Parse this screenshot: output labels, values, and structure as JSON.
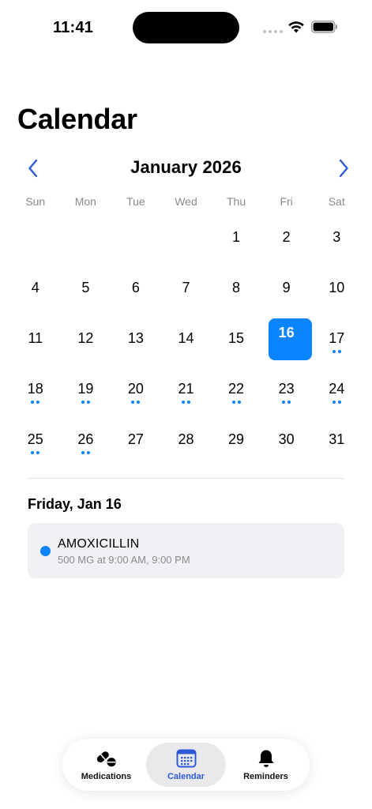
{
  "status_bar": {
    "time": "11:41"
  },
  "page": {
    "title": "Calendar"
  },
  "calendar": {
    "month_label": "January 2026",
    "weekdays": [
      "Sun",
      "Mon",
      "Tue",
      "Wed",
      "Thu",
      "Fri",
      "Sat"
    ],
    "leading_blanks": 4,
    "days": [
      {
        "n": "1",
        "dots": 0
      },
      {
        "n": "2",
        "dots": 0
      },
      {
        "n": "3",
        "dots": 0
      },
      {
        "n": "4",
        "dots": 0
      },
      {
        "n": "5",
        "dots": 0
      },
      {
        "n": "6",
        "dots": 0
      },
      {
        "n": "7",
        "dots": 0
      },
      {
        "n": "8",
        "dots": 0
      },
      {
        "n": "9",
        "dots": 0
      },
      {
        "n": "10",
        "dots": 0
      },
      {
        "n": "11",
        "dots": 0
      },
      {
        "n": "12",
        "dots": 0
      },
      {
        "n": "13",
        "dots": 0
      },
      {
        "n": "14",
        "dots": 0
      },
      {
        "n": "15",
        "dots": 0
      },
      {
        "n": "16",
        "dots": 0,
        "selected": true
      },
      {
        "n": "17",
        "dots": 2
      },
      {
        "n": "18",
        "dots": 2
      },
      {
        "n": "19",
        "dots": 2
      },
      {
        "n": "20",
        "dots": 2
      },
      {
        "n": "21",
        "dots": 2
      },
      {
        "n": "22",
        "dots": 2
      },
      {
        "n": "23",
        "dots": 2
      },
      {
        "n": "24",
        "dots": 2
      },
      {
        "n": "25",
        "dots": 2
      },
      {
        "n": "26",
        "dots": 2
      },
      {
        "n": "27",
        "dots": 0
      },
      {
        "n": "28",
        "dots": 0
      },
      {
        "n": "29",
        "dots": 0
      },
      {
        "n": "30",
        "dots": 0
      },
      {
        "n": "31",
        "dots": 0
      }
    ],
    "accent_color": "#0a84ff"
  },
  "selected_day": {
    "heading": "Friday, Jan 16",
    "medications": [
      {
        "name": "AMOXICILLIN",
        "detail": "500 MG at 9:00 AM, 9:00 PM"
      }
    ]
  },
  "tab_bar": {
    "tabs": [
      {
        "id": "medications",
        "label": "Medications",
        "icon": "pills-icon",
        "active": false
      },
      {
        "id": "calendar",
        "label": "Calendar",
        "icon": "calendar-icon",
        "active": true
      },
      {
        "id": "reminders",
        "label": "Reminders",
        "icon": "bell-icon",
        "active": false
      }
    ]
  }
}
